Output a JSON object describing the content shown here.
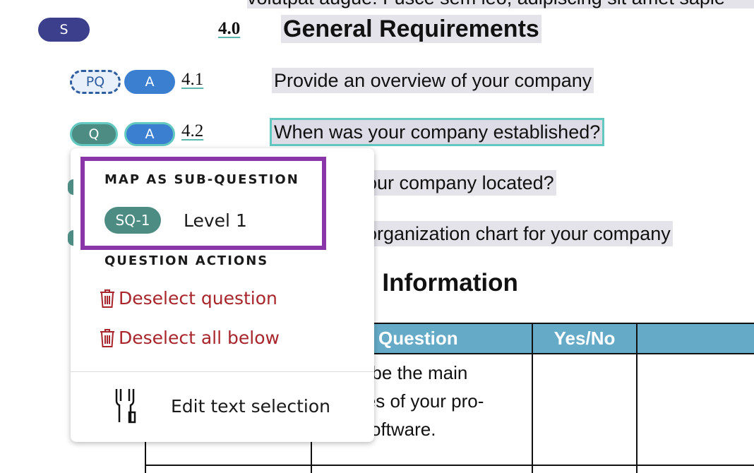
{
  "doc": {
    "top_text": "volutpat augue. Fusce sem leo, adipiscing sit amet sapie",
    "section_4_0": {
      "num": "4.0",
      "title": "General Requirements"
    },
    "q_4_1": {
      "num": "4.1",
      "text": "Provide an overview of your company"
    },
    "q_4_2": {
      "num": "4.2",
      "text": "When was your company established?"
    },
    "q_4_3_partial": "our company located?",
    "q_4_4_partial": "organization chart for your company",
    "section_5_partial": ": Information",
    "table": {
      "headers": [
        "Question",
        "Yes/No"
      ],
      "cell_lines": [
        "ribe the main",
        "ies of your pro-",
        "software."
      ]
    }
  },
  "tags": {
    "s": "S",
    "pq": "PQ",
    "a1": "A",
    "q": "Q",
    "a2": "A"
  },
  "menu": {
    "map_heading": "MAP AS SUB-QUESTION",
    "sub_badge": "SQ-1",
    "sub_level": "Level 1",
    "actions_heading": "QUESTION ACTIONS",
    "deselect_question": "Deselect question",
    "deselect_all_below": "Deselect all below",
    "edit_text_selection": "Edit text selection"
  },
  "colors": {
    "s_badge": "#3b3f8c",
    "a_badge": "#3a7fd0",
    "q_badge": "#4d8c83",
    "q_outline": "#62c8c0",
    "pq_border": "#2f5ea0",
    "pq_fill": "#e8f0fb",
    "highlight_frame": "#8a35a8",
    "danger": "#a8262b",
    "table_header": "#65abc8"
  }
}
